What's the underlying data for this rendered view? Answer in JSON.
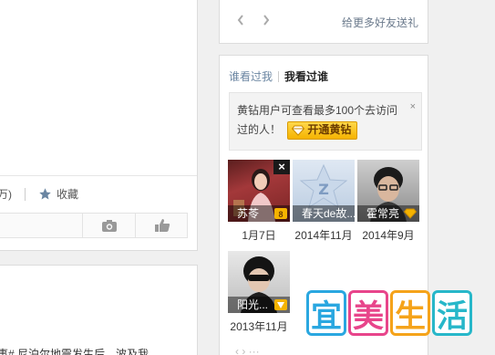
{
  "feed_top": {
    "count_fragment": "万)",
    "collect_label": "收藏"
  },
  "feed_bottom": {
    "snippet": "事# 尼泊尔地震发生后，波及我"
  },
  "gift_panel": {
    "prev_icon": "chevron-left-icon",
    "next_icon": "chevron-right-icon",
    "more_gift": "给更多好友送礼"
  },
  "visitors": {
    "tabs": [
      {
        "label": "谁看过我",
        "active": false
      },
      {
        "label": "我看过谁",
        "active": true
      }
    ],
    "notice": {
      "text_line1": "黄钻用户可查看最多100个去访问",
      "text_line2": "过的人！",
      "button_label": "开通黄钻",
      "close_symbol": "×"
    },
    "items": [
      {
        "name": "苏苓",
        "date": "1月7日",
        "avatar": "person-photo-pink",
        "badge": "vip-badge-icon",
        "has_close": true
      },
      {
        "name": "春天de故...",
        "date": "2014年11月",
        "avatar": "default-qq-avatar",
        "badge": "",
        "has_close": false
      },
      {
        "name": "霍常亮",
        "date": "2014年9月",
        "avatar": "person-photo-glasses",
        "badge": "vip-badge-icon",
        "has_close": false
      },
      {
        "name": "阳光...",
        "date": "2013年11月",
        "avatar": "person-photo-sunglasses",
        "badge": "vip-badge-icon",
        "has_close": false
      }
    ]
  },
  "watermark": {
    "chars": [
      "宜",
      "美",
      "生",
      "活"
    ],
    "colors": [
      "#2aa7e0",
      "#e8458b",
      "#f5a31a",
      "#27b7c9"
    ]
  },
  "colors": {
    "vip_yellow": "#f5b300",
    "link_blue": "#6b86a2"
  }
}
